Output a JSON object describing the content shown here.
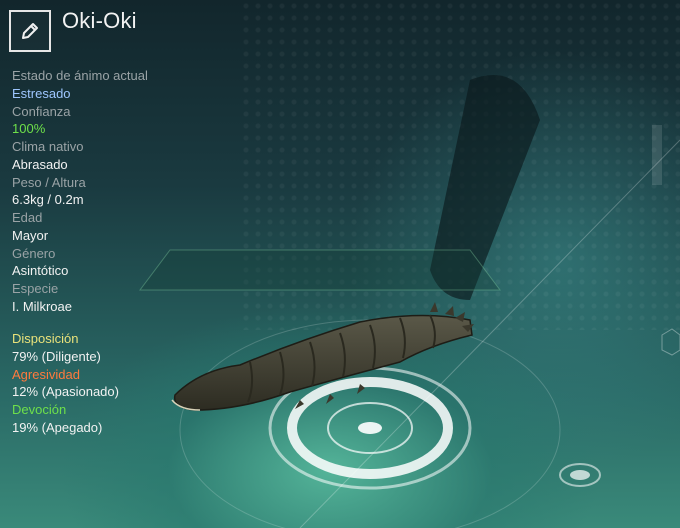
{
  "creature": {
    "name": "Oki-Oki"
  },
  "stats": [
    {
      "label": "Estado de ánimo actual",
      "value": "Estresado"
    },
    {
      "label": "Confianza",
      "value": "100%"
    },
    {
      "label": "Clima nativo",
      "value": "Abrasado"
    },
    {
      "label": "Peso / Altura",
      "value": "6.3kg / 0.2m"
    },
    {
      "label": "Edad",
      "value": "Mayor"
    },
    {
      "label": "Género",
      "value": "Asintótico"
    },
    {
      "label": "Especie",
      "value": "I. Milkroae"
    }
  ],
  "traits": [
    {
      "label": "Disposición",
      "value": "79% (Diligente)"
    },
    {
      "label": "Agresividad",
      "value": "12% (Apasionado)"
    },
    {
      "label": "Devoción",
      "value": "19% (Apegado)"
    }
  ],
  "colors": {
    "mood_value": "#9ec6ff",
    "trust_value": "#6ee04a",
    "disposition": "#e9e27a",
    "aggression": "#ff7a3d",
    "devotion": "#6ee04a"
  },
  "icons": {
    "edit": "pencil-icon"
  }
}
